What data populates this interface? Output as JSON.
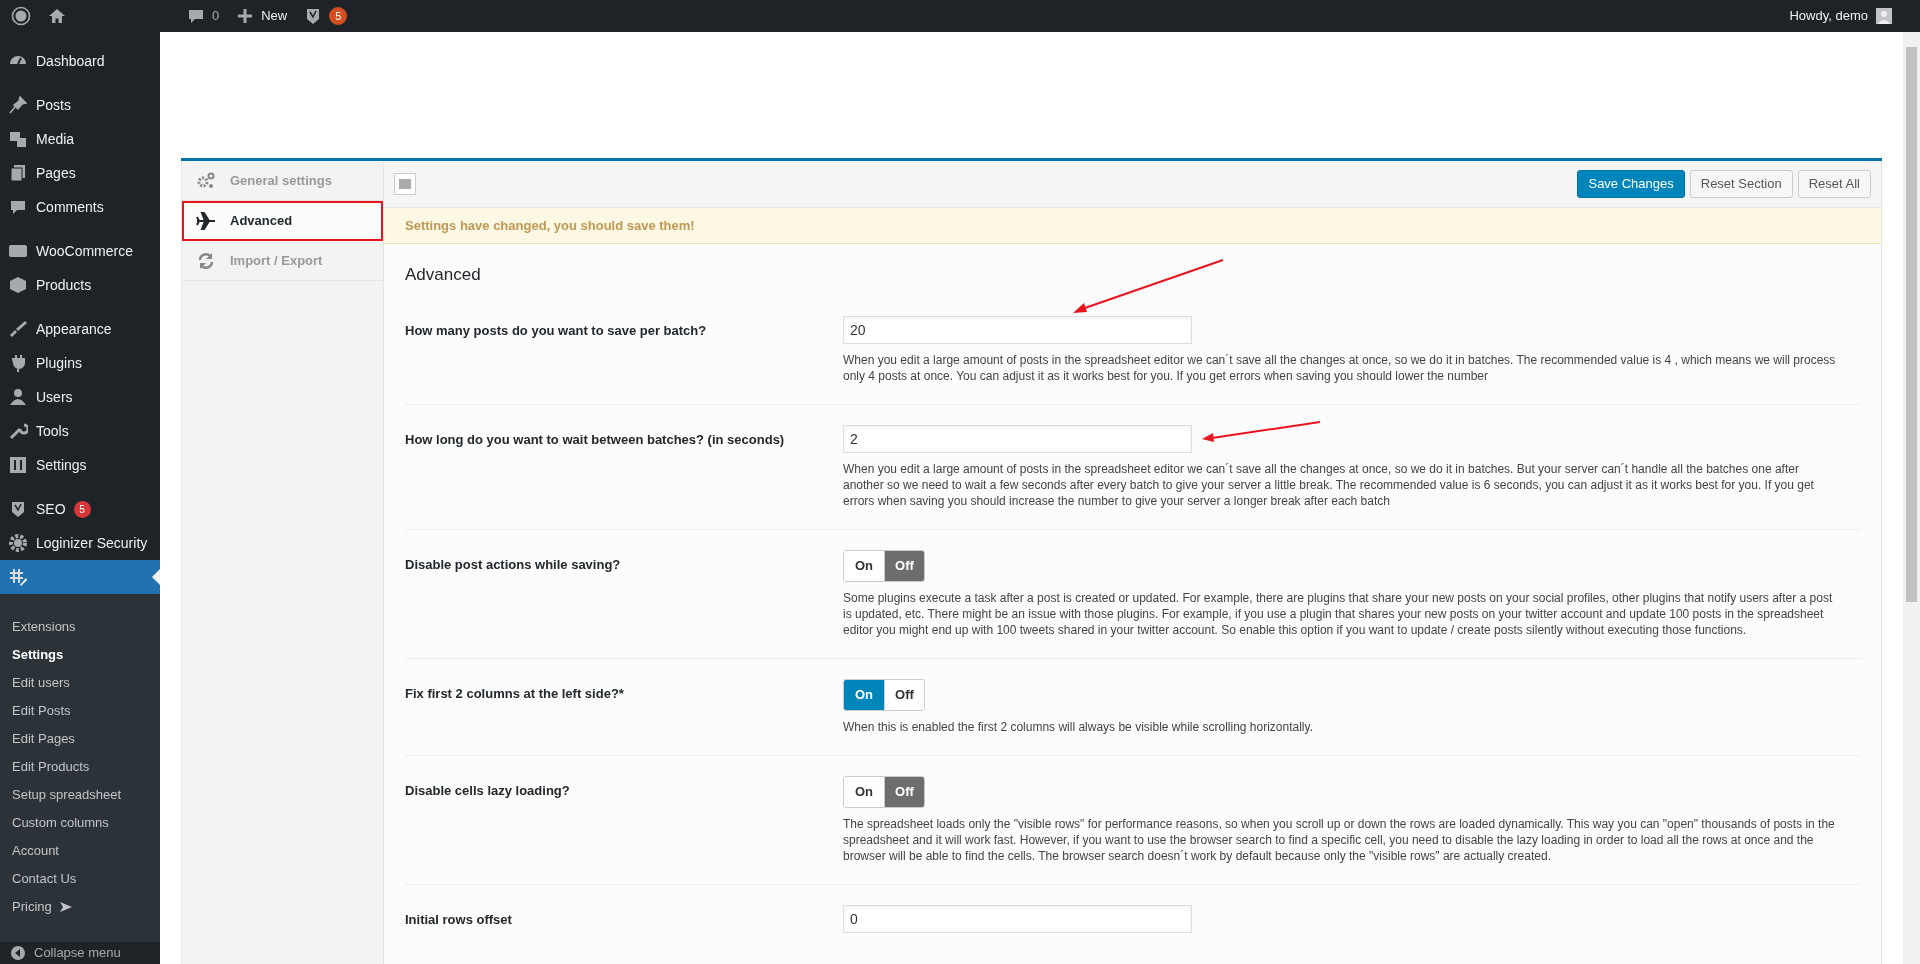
{
  "admin_bar": {
    "comments_count": "0",
    "new_label": "New",
    "seo_badge": "5",
    "greeting": "Howdy, demo"
  },
  "sidebar": {
    "menu_groups": [
      [
        {
          "label": "Dashboard",
          "selected": false
        }
      ],
      [
        {
          "label": "Posts",
          "selected": false
        },
        {
          "label": "Media",
          "selected": false
        },
        {
          "label": "Pages",
          "selected": false
        },
        {
          "label": "Comments",
          "selected": false
        }
      ],
      [
        {
          "label": "WooCommerce",
          "selected": false
        },
        {
          "label": "Products",
          "selected": false
        }
      ],
      [
        {
          "label": "Appearance",
          "selected": false
        },
        {
          "label": "Plugins",
          "selected": false
        },
        {
          "label": "Users",
          "selected": false
        },
        {
          "label": "Tools",
          "selected": false
        },
        {
          "label": "Settings",
          "selected": false
        }
      ],
      [
        {
          "label": "SEO",
          "badge": "5",
          "selected": false
        },
        {
          "label": "Loginizer Security",
          "selected": false
        },
        {
          "selected": true
        }
      ]
    ],
    "submenu": [
      {
        "label": "Extensions",
        "selected": false
      },
      {
        "label": "Settings",
        "selected": true
      },
      {
        "label": "Edit users",
        "selected": false
      },
      {
        "label": "Edit Posts",
        "selected": false
      },
      {
        "label": "Edit Pages",
        "selected": false
      },
      {
        "label": "Edit Products",
        "selected": false
      },
      {
        "label": "Setup spreadsheet",
        "selected": false
      },
      {
        "label": "Custom columns",
        "selected": false
      },
      {
        "label": "Account",
        "selected": false
      },
      {
        "label": "Contact Us",
        "selected": false
      },
      {
        "label": "Pricing",
        "arrow": true,
        "selected": false
      }
    ],
    "collapse_label": "Collapse menu"
  },
  "settings_nav": [
    {
      "label": "General settings",
      "selected": false,
      "annotated": false
    },
    {
      "label": "Advanced",
      "selected": true,
      "annotated": true
    },
    {
      "label": "Import / Export",
      "selected": false,
      "annotated": false
    }
  ],
  "toolbar_buttons": [
    {
      "label": "Save Changes",
      "kind": "primary"
    },
    {
      "label": "Reset Section",
      "kind": "secondary"
    },
    {
      "label": "Reset All",
      "kind": "secondary"
    }
  ],
  "notice": "Settings have changed, you should save them!",
  "section_title": "Advanced",
  "fields": [
    {
      "kind": "text",
      "label": "How many posts do you want to save per batch?",
      "value": "20",
      "description": "When you edit a large amount of posts in the spreadsheet editor we can´t save all the changes at once, so we do it in batches. The recommended value is 4 , which means we will process only 4 posts at once. You can adjust it as it works best for you. If you get errors when saving you should lower the number"
    },
    {
      "kind": "text",
      "label": "How long do you want to wait between batches? (in seconds)",
      "value": "2",
      "description": "When you edit a large amount of posts in the spreadsheet editor we can´t save all the changes at once, so we do it in batches. But your server can´t handle all the batches one after another so we need to wait a few seconds after every batch to give your server a little break. The recommended value is 6 seconds, you can adjust it as it works best for you. If you get errors when saving you should increase the number to give your server a longer break after each batch"
    },
    {
      "kind": "toggle",
      "label": "Disable post actions while saving?",
      "on": false,
      "on_label": "On",
      "off_label": "Off",
      "description": "Some plugins execute a task after a post is created or updated. For example, there are plugins that share your new posts on your social profiles, other plugins that notify users after a post is updated, etc. There might be an issue with those plugins. For example, if you use a plugin that shares your new posts on your twitter account and update 100 posts in the spreadsheet editor you might end up with 100 tweets shared in your twitter account. So enable this option if you want to update / create posts silently without executing those functions."
    },
    {
      "kind": "toggle",
      "label": "Fix first 2 columns at the left side?*",
      "on": true,
      "on_label": "On",
      "off_label": "Off",
      "description": "When this is enabled the first 2 columns will always be visible while scrolling horizontally."
    },
    {
      "kind": "toggle",
      "label": "Disable cells lazy loading?",
      "on": false,
      "on_label": "On",
      "off_label": "Off",
      "description": "The spreadsheet loads only the \"visible rows\" for performance reasons, so when you scroll up or down the rows are loaded dynamically. This way you can \"open\" thousands of posts in the spreadsheet and it will work fast. However, if you want to use the browser search to find a specific cell, you need to disable the lazy loading in order to load all the rows at once and the browser will be able to find the cells. The browser search doesn´t work by default because only the \"visible rows\" are actually created."
    },
    {
      "kind": "text",
      "label": "Initial rows offset",
      "value": "0"
    }
  ]
}
